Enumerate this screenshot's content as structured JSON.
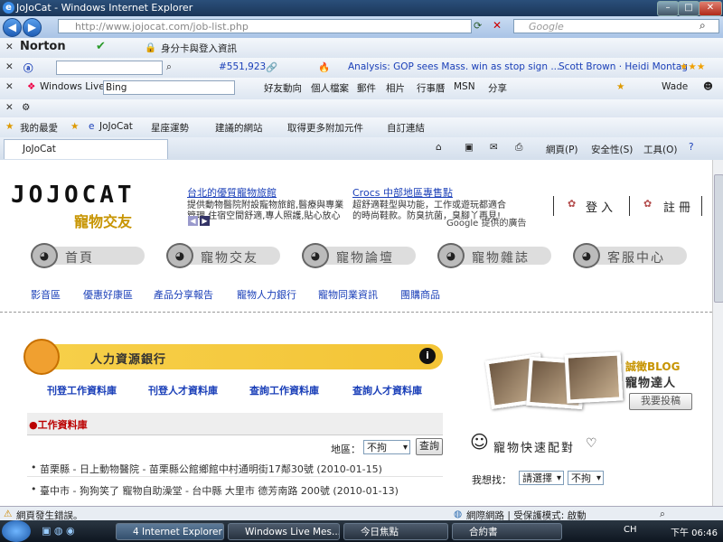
{
  "window": {
    "title": "JoJoCat - Windows Internet Explorer"
  },
  "address": {
    "url": "http://www.jojocat.com/job-list.php",
    "search_placeholder": "Google"
  },
  "norton": {
    "brand": "Norton",
    "item1": "身分卡與登入資訊"
  },
  "toolbar2": {
    "count": "#551,923",
    "news": "Analysis: GOP sees Mass. win as stop sign ...",
    "people": "Scott Brown · Heidi Montag"
  },
  "toolbar3": {
    "windows_live": "Windows Live",
    "search_value": "Bing",
    "links": [
      "好友動向",
      "個人檔案",
      "郵件",
      "相片",
      "行事曆",
      "MSN",
      "分享"
    ],
    "user": "Wade"
  },
  "favbar": {
    "fav": "我的最愛",
    "items": [
      "JoJoCat",
      "星座運勢",
      "建議的網站",
      "取得更多附加元件",
      "自訂連結"
    ]
  },
  "tab": {
    "label": "JoJoCat",
    "tools": [
      "網頁(P)",
      "安全性(S)",
      "工具(O)"
    ]
  },
  "site": {
    "logo": "JOJOCAT",
    "logo_sub": "寵物交友",
    "ad1_title": "台北的優質寵物旅館",
    "ad1_text": "提供動物醫院附設寵物旅館,醫療與專業 管理,住宿空間舒適,專人照護,貼心放心",
    "ad2_title": "Crocs 中部地區專售點",
    "ad2_text": "超舒適鞋型與功能，工作或遊玩都適合 的時尚鞋款。防臭抗菌，臭腳丫再見!",
    "google_ads": "Google 提供的廣告",
    "login": "登入",
    "register": "註冊",
    "nav": [
      "首頁",
      "寵物交友",
      "寵物論壇",
      "寵物雜誌",
      "客服中心"
    ],
    "subnav": [
      "影音區",
      "優惠好康區",
      "產品分享報告",
      "寵物人力銀行",
      "寵物同業資訊",
      "團購商品"
    ],
    "banner_title": "人力資源銀行",
    "job_links": [
      "刊登工作資料庫",
      "刊登人才資料庫",
      "查詢工作資料庫",
      "查詢人才資料庫"
    ],
    "jobs_header": "●工作資料庫",
    "area_label": "地區：",
    "area_value": "不拘",
    "search_button": "查詢",
    "jobs": [
      "苗栗縣 - 日上動物醫院 - 苗栗縣公館鄉館中村通明街17鄰30號 (2010-01-15)",
      "臺中市 - 狗狗笑了 寵物自助澡堂 - 台中縣 大里市 德芳南路 200號 (2010-01-13)"
    ],
    "blog_label": "誠徵BLOG",
    "blog_sub": "寵物達人",
    "blog_button": "我要投稿",
    "match_title": "寵物快速配對",
    "want_label": "我想找：",
    "want_value": "請選擇",
    "want_value2": "不拘"
  },
  "status": {
    "left": "網頁發生錯誤。",
    "zone": "網際網路 | 受保護模式: 啟動"
  },
  "taskbar": {
    "tasks": [
      "4 Internet Explorer",
      "Windows Live Mes...",
      "今日焦點",
      "合約書"
    ],
    "lang": "CH",
    "clock": "下午 06:46"
  }
}
